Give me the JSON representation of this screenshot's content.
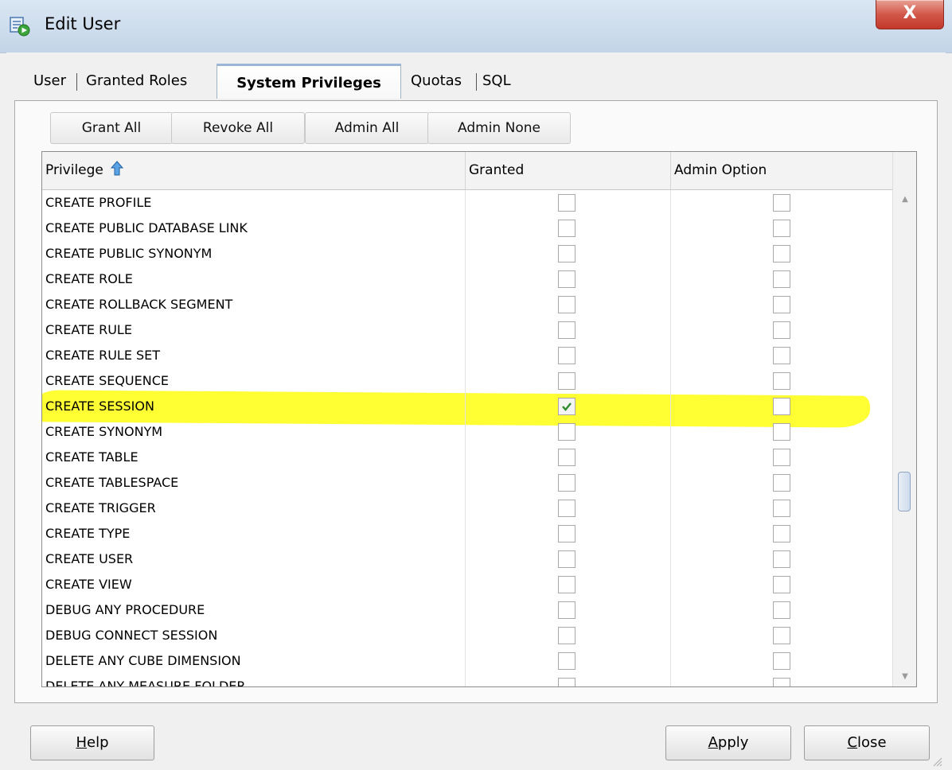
{
  "window": {
    "title": "Edit User",
    "close_glyph": "X"
  },
  "tabs": [
    {
      "label": "User",
      "active": false
    },
    {
      "label": "Granted Roles",
      "active": false
    },
    {
      "label": "System Privileges",
      "active": true
    },
    {
      "label": "Quotas",
      "active": false
    },
    {
      "label": "SQL",
      "active": false
    }
  ],
  "toolbar": {
    "grant_all": "Grant All",
    "revoke_all": "Revoke All",
    "admin_all": "Admin All",
    "admin_none": "Admin None"
  },
  "table": {
    "columns": {
      "privilege": "Privilege",
      "granted": "Granted",
      "admin_option": "Admin Option"
    },
    "rows": [
      {
        "privilege": "CREATE PROFILE",
        "granted": false,
        "admin": false
      },
      {
        "privilege": "CREATE PUBLIC DATABASE LINK",
        "granted": false,
        "admin": false
      },
      {
        "privilege": "CREATE PUBLIC SYNONYM",
        "granted": false,
        "admin": false
      },
      {
        "privilege": "CREATE ROLE",
        "granted": false,
        "admin": false
      },
      {
        "privilege": "CREATE ROLLBACK SEGMENT",
        "granted": false,
        "admin": false
      },
      {
        "privilege": "CREATE RULE",
        "granted": false,
        "admin": false
      },
      {
        "privilege": "CREATE RULE SET",
        "granted": false,
        "admin": false
      },
      {
        "privilege": "CREATE SEQUENCE",
        "granted": false,
        "admin": false
      },
      {
        "privilege": "CREATE SESSION",
        "granted": true,
        "admin": false
      },
      {
        "privilege": "CREATE SYNONYM",
        "granted": false,
        "admin": false
      },
      {
        "privilege": "CREATE TABLE",
        "granted": false,
        "admin": false
      },
      {
        "privilege": "CREATE TABLESPACE",
        "granted": false,
        "admin": false
      },
      {
        "privilege": "CREATE TRIGGER",
        "granted": false,
        "admin": false
      },
      {
        "privilege": "CREATE TYPE",
        "granted": false,
        "admin": false
      },
      {
        "privilege": "CREATE USER",
        "granted": false,
        "admin": false
      },
      {
        "privilege": "CREATE VIEW",
        "granted": false,
        "admin": false
      },
      {
        "privilege": "DEBUG ANY PROCEDURE",
        "granted": false,
        "admin": false
      },
      {
        "privilege": "DEBUG CONNECT SESSION",
        "granted": false,
        "admin": false
      },
      {
        "privilege": "DELETE ANY CUBE DIMENSION",
        "granted": false,
        "admin": false
      },
      {
        "privilege": "DELETE ANY MEASURE FOLDER",
        "granted": false,
        "admin": false
      }
    ]
  },
  "footer": {
    "help": {
      "mnemonic": "H",
      "rest": "elp"
    },
    "apply": {
      "mnemonic": "A",
      "rest": "pply"
    },
    "close": {
      "mnemonic": "C",
      "rest": "lose"
    }
  },
  "colors": {
    "highlight": "#ffff00",
    "check": "#2e8b2e",
    "active_tab_border": "#9bb6d6"
  }
}
